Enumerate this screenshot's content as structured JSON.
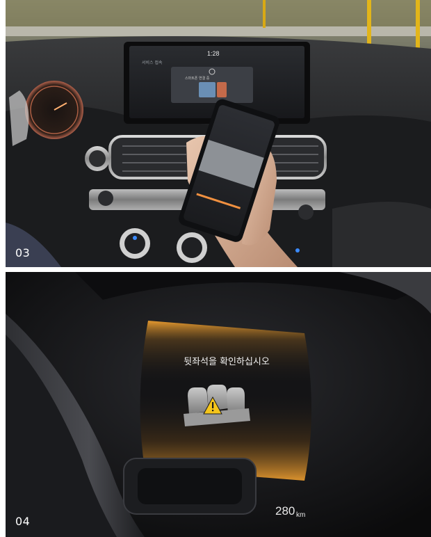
{
  "panels": [
    {
      "number": "03",
      "scene": "car-interior-phone-screen-mirroring",
      "infotainment": {
        "time": "1:28",
        "menu_label": "서비스 접속",
        "popup_text": "스마트폰 연결 중"
      }
    },
    {
      "number": "04",
      "scene": "instrument-cluster-rear-seat-alert",
      "cluster": {
        "warning_text": "뒷좌석을 확인하십시오",
        "range_value": "280",
        "range_unit": "km"
      }
    }
  ],
  "colors": {
    "cluster_glow": "#f0a030",
    "warning_yellow": "#f5c51a",
    "ambient_blue": "#3b8bff"
  }
}
